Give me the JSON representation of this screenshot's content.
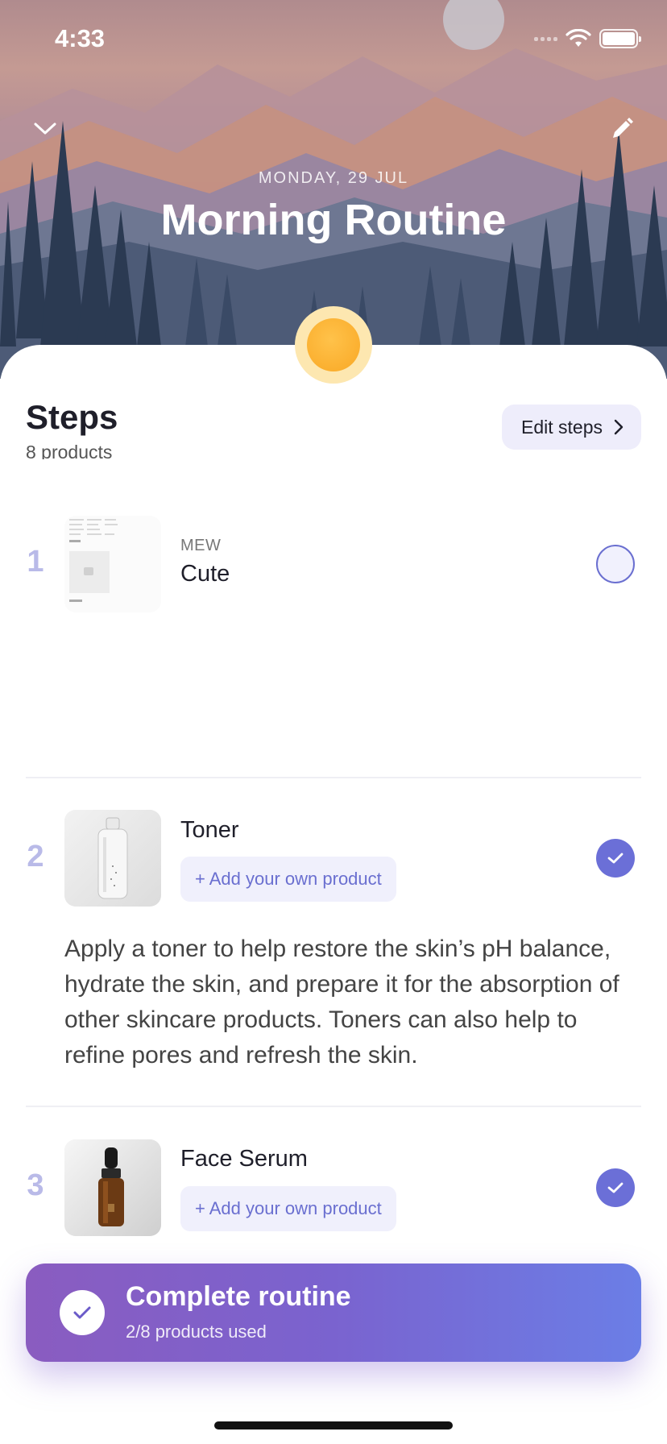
{
  "status_bar": {
    "time": "4:33"
  },
  "header": {
    "date": "MONDAY, 29 JUL",
    "title": "Morning Routine"
  },
  "steps_section": {
    "title": "Steps",
    "subtitle": "8 products",
    "edit_label": "Edit steps"
  },
  "steps": [
    {
      "number": "1",
      "brand": "MEW",
      "name": "Cute",
      "completed": false
    },
    {
      "number": "2",
      "name": "Toner",
      "add_label": "+ Add your own product",
      "completed": true,
      "description": "Apply a toner to help restore the skin’s pH balance, hydrate the skin, and prepare it for the absorption of other skincare products. Toners can also help to refine pores and refresh the skin."
    },
    {
      "number": "3",
      "name": "Face Serum",
      "add_label": "+ Add your own product",
      "completed": true
    }
  ],
  "complete_routine": {
    "title": "Complete routine",
    "subtitle": "2/8 products used"
  },
  "colors": {
    "accent": "#6b6fd7",
    "step_number": "#b9bae8",
    "sun": "#f9a825"
  },
  "icons": {
    "collapse": "chevron-down-icon",
    "edit": "pencil-icon",
    "edit_steps": "chevron-right-icon",
    "check": "checkmark-icon"
  }
}
